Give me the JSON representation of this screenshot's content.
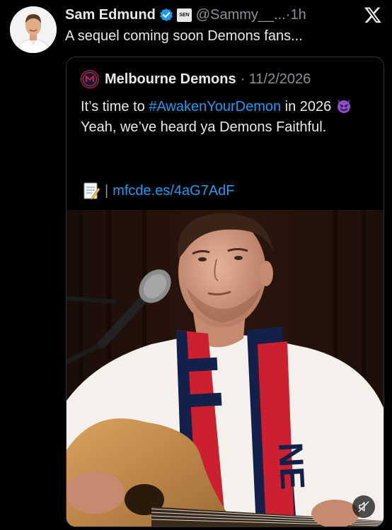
{
  "tweet": {
    "author_name": "Sam Edmund",
    "affiliation_badge": "SEN",
    "handle_time": "@Sammy__...·1h",
    "text": "A sequel coming soon Demons fans..."
  },
  "quote": {
    "author_name": "Melbourne Demons",
    "date": "· 11/2/2026",
    "body_pre": "It’s time to ",
    "hashtag": "#AwakenYourDemon",
    "body_mid": " in 2026 ",
    "body_post": " Yeah, we’ve heard ya Demons Faithful.",
    "link_separator": "|",
    "link": "mfcde.es/4aG7AdF"
  },
  "icons": {
    "avatar": "avatar-photo",
    "verified": "verified-badge-icon",
    "x_logo": "x-logo-icon",
    "club_logo": "melbourne-demons-logo-icon",
    "devil_emoji": "smiling-devil-icon",
    "memo_emoji": "memo-icon",
    "mute": "muted-speaker-icon"
  },
  "colors": {
    "background": "#000000",
    "text": "#e7e9ea",
    "muted": "#8b8f94",
    "link": "#1d9bf0",
    "verified": "#1d9bf0",
    "border": "#2f3336"
  }
}
